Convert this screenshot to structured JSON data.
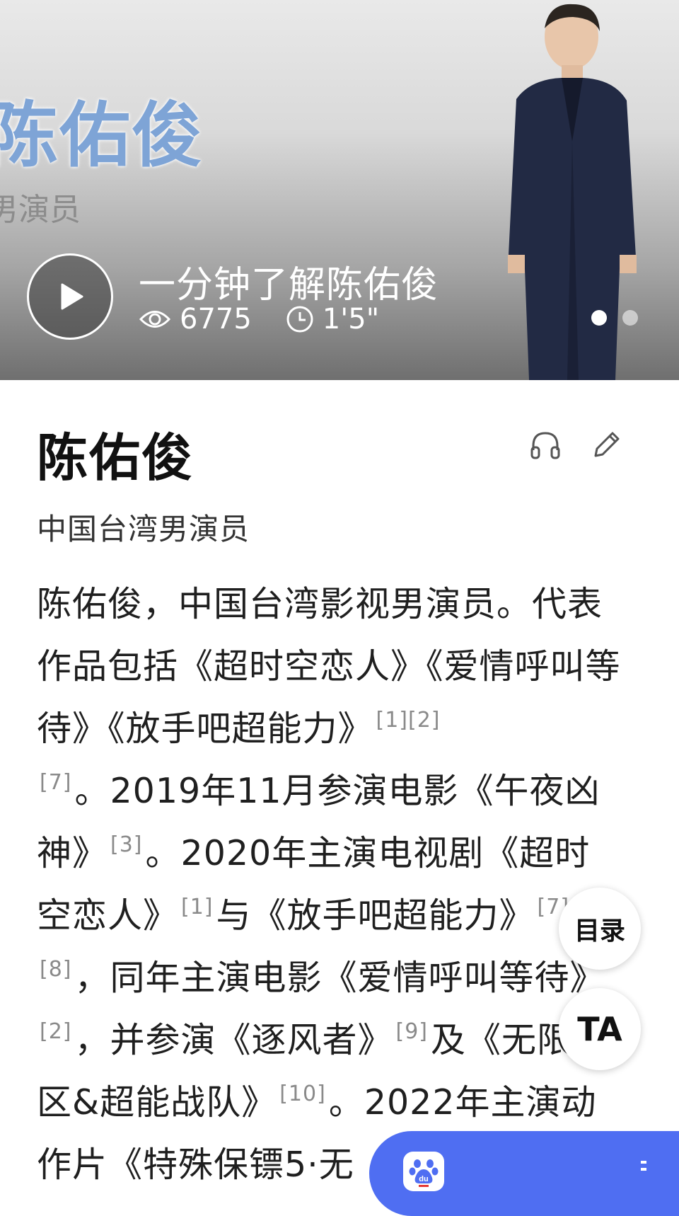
{
  "hero": {
    "overlay_name": "陈佑俊",
    "overlay_subtitle": "男演员",
    "video_title": "一分钟了解陈佑俊",
    "views": "6775",
    "duration": "1'5\"",
    "carousel_active_index": 0,
    "carousel_count": 2
  },
  "article": {
    "title": "陈佑俊",
    "subtitle": "中国台湾男演员",
    "p1": "陈佑俊，中国台湾影视男演员。代表作品包括《超时空恋人》《爱情呼叫等待》《放手吧超能力》",
    "r1": "[1][2]",
    "r2": "[7]",
    "p2": "。2019年11月参演电影《午夜凶神》",
    "r3": "[3]",
    "p3": "。2020年主演电视剧《超时空恋人》",
    "r4": "[1]",
    "p4": "与《放手吧超能力》",
    "r5": "[7]",
    "r6": "[8]",
    "p5": "，同年主演电影《爱情呼叫等待》",
    "r7": "[2]",
    "p6": "，并参演《逐风者》",
    "r8": "[9]",
    "p7": "及《无限街区&超能战队》",
    "r9": "[10]",
    "p8": "。2022年主演动作片《特殊保镖5·无"
  },
  "floating": {
    "toc_label": "目录",
    "font_label": "TA"
  },
  "colors": {
    "accent_blue": "#4f6ef2",
    "overlay_name_blue": "#7ea4d6"
  },
  "icons": [
    "play-icon",
    "eye-icon",
    "clock-icon",
    "headphones-icon",
    "pencil-icon",
    "baidu-paw-icon"
  ]
}
